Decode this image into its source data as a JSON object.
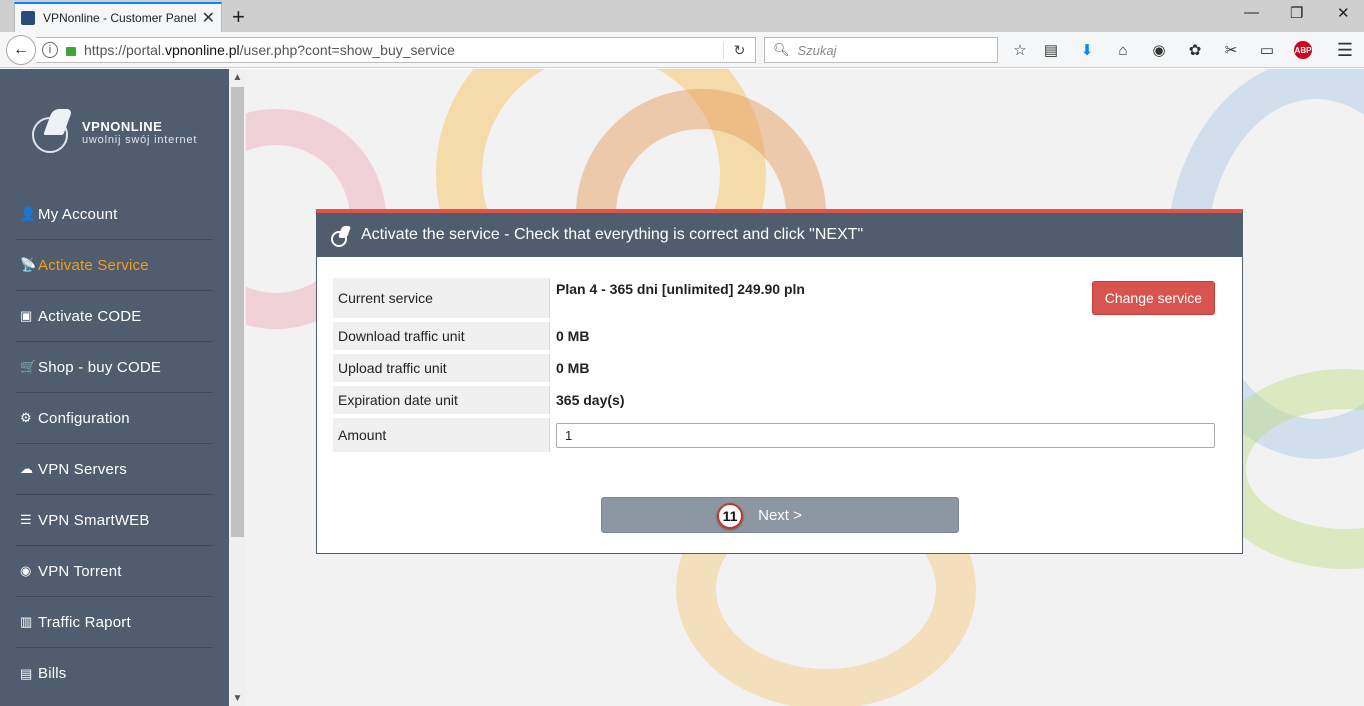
{
  "browser": {
    "tab_title": "VPNonline - Customer Panel",
    "tab_close": "✕",
    "new_tab": "+",
    "url_prefix": "https://portal.",
    "url_domain": "vpnonline.pl",
    "url_path": "/user.php?cont=show_buy_service",
    "search_placeholder": "Szukaj",
    "window_minimize": "—",
    "window_restore": "❐",
    "window_close": "✕",
    "abp_label": "ABP"
  },
  "logo": {
    "name": "VPNONLINE",
    "tagline": "uwolnij swój internet"
  },
  "sidebar": {
    "items": [
      {
        "label": "My Account",
        "icon": "user-icon",
        "glyph": "👤"
      },
      {
        "label": "Activate Service",
        "icon": "satellite-icon",
        "glyph": "📡"
      },
      {
        "label": "Activate CODE",
        "icon": "wallet-icon",
        "glyph": "▣"
      },
      {
        "label": "Shop - buy CODE",
        "icon": "basket-icon",
        "glyph": "🛒"
      },
      {
        "label": "Configuration",
        "icon": "cogs-icon",
        "glyph": "⚙"
      },
      {
        "label": "VPN Servers",
        "icon": "cloud-icon",
        "glyph": "☁"
      },
      {
        "label": "VPN SmartWEB",
        "icon": "list-icon",
        "glyph": "☰"
      },
      {
        "label": "VPN Torrent",
        "icon": "torrent-icon",
        "glyph": "◉"
      },
      {
        "label": "Traffic Raport",
        "icon": "bar-chart-icon",
        "glyph": "▥"
      },
      {
        "label": "Bills",
        "icon": "file-icon",
        "glyph": "▤"
      }
    ],
    "active_index": 1
  },
  "panel": {
    "title": "Activate the service - Check that everything is correct and click \"NEXT\"",
    "rows": {
      "current_service": {
        "label": "Current service",
        "value": "Plan 4 - 365 dni [unlimited] 249.90 pln"
      },
      "download": {
        "label": "Download traffic unit",
        "value": "0 MB"
      },
      "upload": {
        "label": "Upload traffic unit",
        "value": "0 MB"
      },
      "expiration": {
        "label": "Expiration date unit",
        "value": "365 day(s)"
      },
      "amount": {
        "label": "Amount",
        "value": "1"
      }
    },
    "change_service_label": "Change service",
    "next_label": "Next >",
    "step_badge": "11"
  },
  "colors": {
    "sidebar_bg": "#4f5d6e",
    "active_item": "#f39a1b",
    "panel_accent": "#e2534b",
    "change_button": "#d9534f",
    "next_button": "#8c97a2"
  }
}
